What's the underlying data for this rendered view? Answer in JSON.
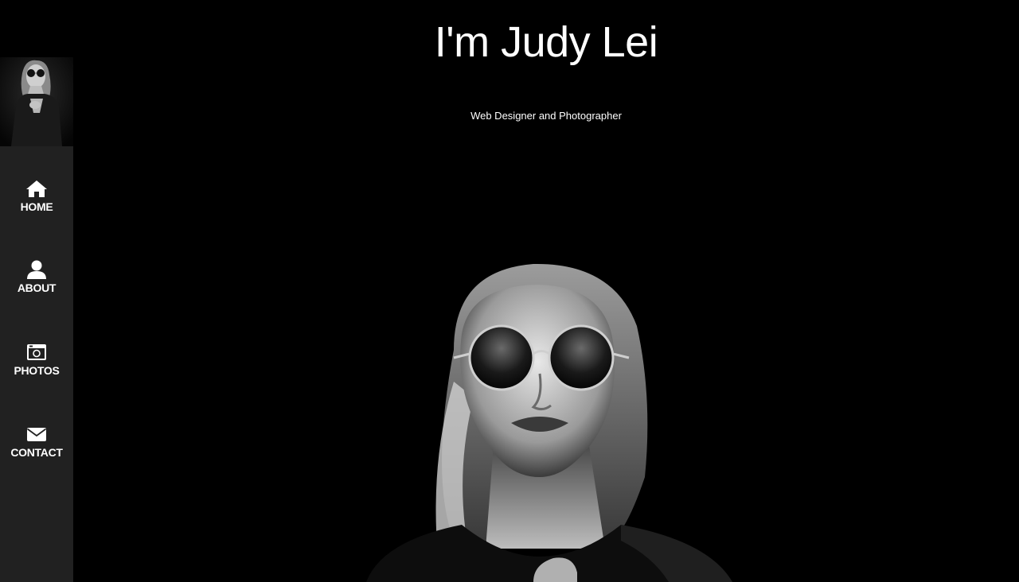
{
  "hero": {
    "title": "I'm Judy Lei",
    "subtitle": "Web Designer and Photographer"
  },
  "sidebar": {
    "items": [
      {
        "label": "HOME",
        "icon": "home-icon"
      },
      {
        "label": "ABOUT",
        "icon": "user-icon"
      },
      {
        "label": "PHOTOS",
        "icon": "camera-icon"
      },
      {
        "label": "CONTACT",
        "icon": "envelope-icon"
      }
    ]
  },
  "colors": {
    "background": "#000000",
    "sidebar": "#212121",
    "text": "#ffffff"
  }
}
